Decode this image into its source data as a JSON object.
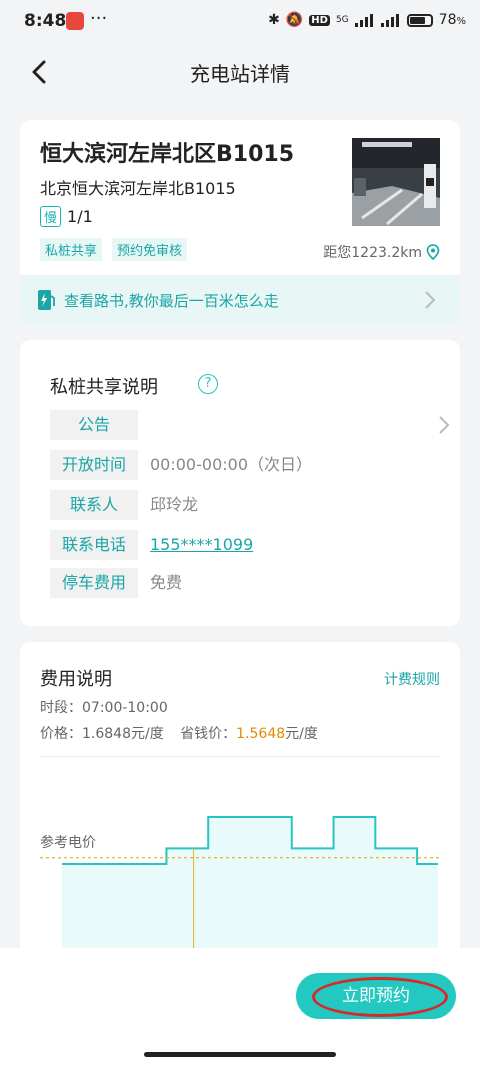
{
  "status_bar": {
    "time": "8:48",
    "battery": "78",
    "battery_unit": "%",
    "network": "5G",
    "hd": "HD"
  },
  "nav": {
    "title": "充电站详情"
  },
  "station": {
    "name": "恒大滨河左岸北区B1015",
    "address": "北京恒大滨河左岸北B1015",
    "slow_badge": "慢",
    "slow_count": "1/1",
    "tags": [
      "私桩共享",
      "预约免审核"
    ],
    "distance": "距您1223.2km",
    "guide_text": "查看路书,教你最后一百米怎么走"
  },
  "share": {
    "title": "私桩共享说明",
    "help_glyph": "?",
    "rows": [
      {
        "key": "公告",
        "value": ""
      },
      {
        "key": "开放时间",
        "value": "00:00-00:00（次日）"
      },
      {
        "key": "联系人",
        "value": "邱玲龙"
      },
      {
        "key": "联系电话",
        "value": "155****1099"
      },
      {
        "key": "停车费用",
        "value": "免费"
      }
    ]
  },
  "fee": {
    "title": "费用说明",
    "rule_link": "计费规则",
    "period": "时段：07:00-10:00",
    "price": "价格：1.6848元/度",
    "saving_label": "省钱价：",
    "saving_value": "1.5648",
    "saving_unit": "元/度",
    "ref_label": "参考电价"
  },
  "chart_data": {
    "type": "area",
    "step": true,
    "series": [
      {
        "values": [
          1.5,
          1.5,
          1.5,
          1.5,
          1.5,
          2.0,
          2.0,
          3.0,
          3.0,
          3.0,
          3.0,
          2.0,
          2.0,
          3.0,
          3.0,
          2.0,
          2.0,
          1.5
        ]
      }
    ],
    "reference_line": 1.7,
    "colors": {
      "line": "#27c4c4",
      "fill": "#e9fafa",
      "reference": "#e6b422"
    }
  },
  "action": {
    "book_label": "立即预约"
  },
  "colors": {
    "accent": "#23c9c0",
    "highlight_circle": "#d42a2a"
  }
}
